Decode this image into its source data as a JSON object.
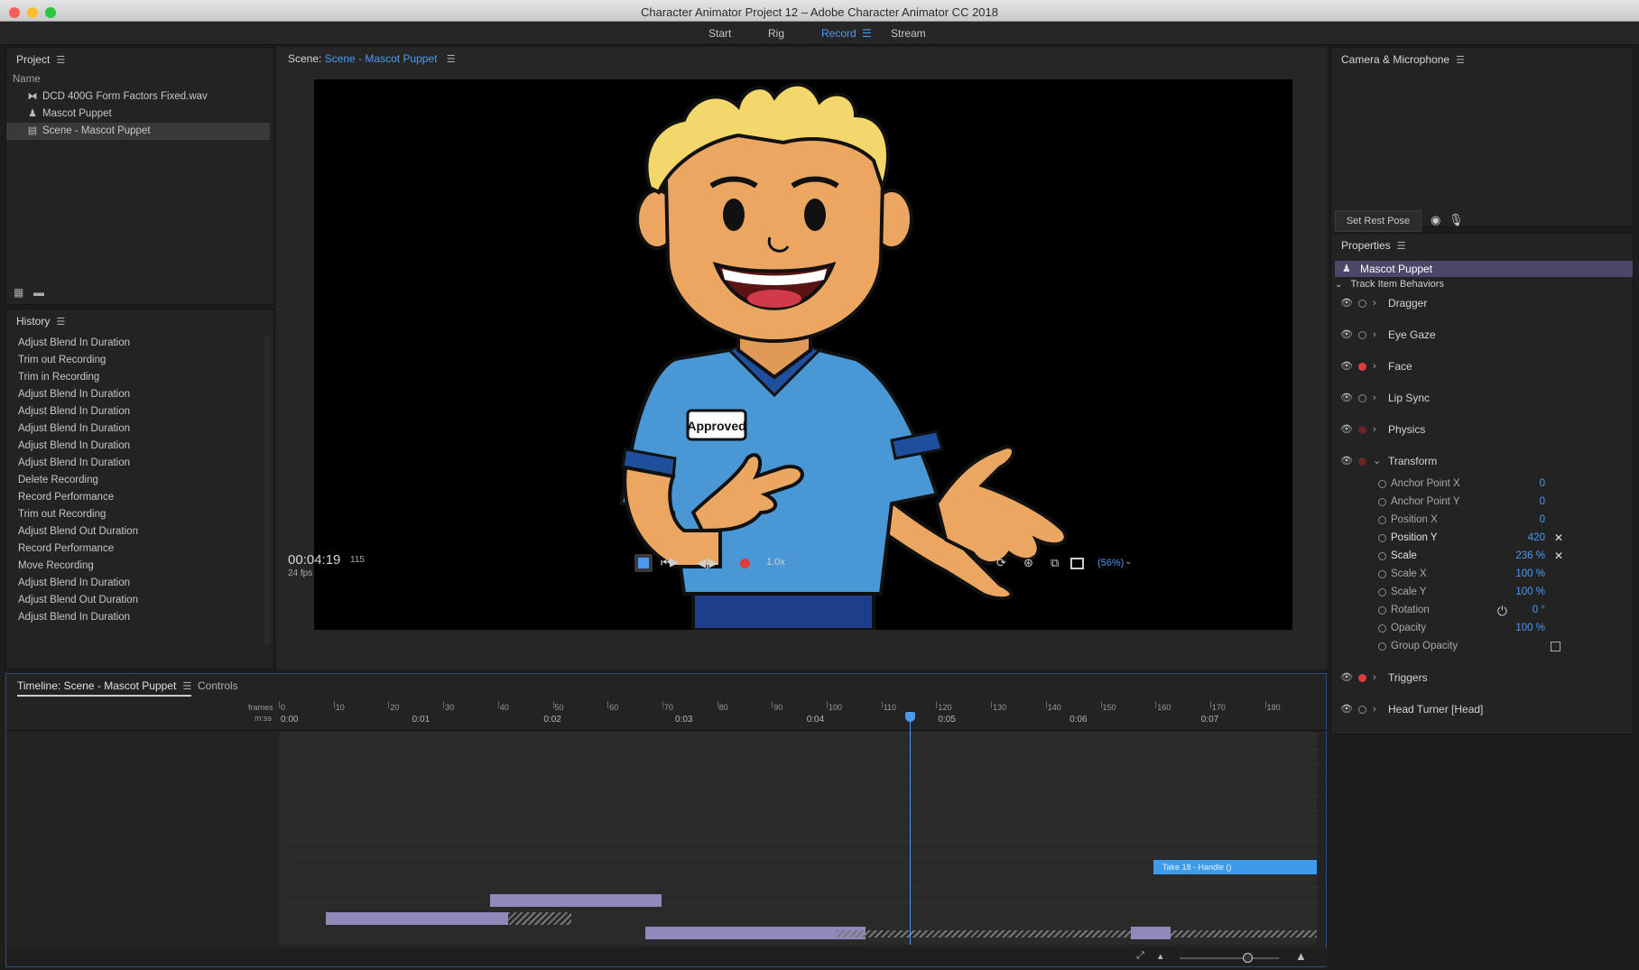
{
  "window": {
    "title": "Character Animator Project 12 – Adobe Character Animator CC 2018"
  },
  "workspace": {
    "tabs": [
      "Start",
      "Rig",
      "Record",
      "Stream"
    ],
    "active": "Record"
  },
  "project": {
    "title": "Project",
    "column_name": "Name",
    "items": [
      {
        "name": "DCD 400G Form Factors Fixed.wav",
        "icon": "audio-waveform-icon"
      },
      {
        "name": "Mascot Puppet",
        "icon": "puppet-icon"
      },
      {
        "name": "Scene - Mascot Puppet",
        "icon": "scene-clapper-icon",
        "selected": true
      }
    ]
  },
  "history": {
    "title": "History",
    "items": [
      "Adjust Blend In Duration",
      "Trim out Recording",
      "Trim in Recording",
      "Adjust Blend In Duration",
      "Adjust Blend In Duration",
      "Adjust Blend In Duration",
      "Adjust Blend In Duration",
      "Adjust Blend In Duration",
      "Delete Recording",
      "Record Performance",
      "Trim out Recording",
      "Adjust Blend Out Duration",
      "Record Performance",
      "Move Recording",
      "Adjust Blend In Duration",
      "Adjust Blend Out Duration",
      "Adjust Blend In Duration"
    ]
  },
  "scene": {
    "label": "Scene:",
    "name": "Scene - Mascot Puppet",
    "badge_text": "Approved",
    "timecode": "00:04:19",
    "frame": "115",
    "fps": "24 fps",
    "speed": "1.0x",
    "zoom": "(56%)"
  },
  "camera": {
    "title": "Camera & Microphone",
    "rest_pose": "Set Rest Pose"
  },
  "properties": {
    "title": "Properties",
    "puppet": "Mascot Puppet",
    "section": "Track Item Behaviors",
    "behaviors": [
      "Dragger",
      "Eye Gaze",
      "Face",
      "Lip Sync",
      "Physics",
      "Transform"
    ],
    "transform_params": [
      {
        "name": "Anchor Point X",
        "value": "0"
      },
      {
        "name": "Anchor Point Y",
        "value": "0"
      },
      {
        "name": "Position X",
        "value": "0"
      },
      {
        "name": "Position Y",
        "value": "420"
      },
      {
        "name": "Scale",
        "value": "236 %"
      },
      {
        "name": "Scale X",
        "value": "100 %"
      },
      {
        "name": "Scale Y",
        "value": "100 %"
      },
      {
        "name": "Rotation",
        "value": "0 °"
      },
      {
        "name": "Opacity",
        "value": "100 %"
      },
      {
        "name": "Group Opacity",
        "value": ""
      }
    ],
    "after": [
      "Triggers",
      "Head Turner [Head]"
    ]
  },
  "timeline": {
    "title": "Timeline: Scene - Mascot Puppet",
    "controls_tab": "Controls",
    "frames_label": "frames",
    "mss_label": "m:ss",
    "frame_ticks": [
      "0",
      "10",
      "20",
      "30",
      "40",
      "50",
      "60",
      "70",
      "80",
      "90",
      "100",
      "110",
      "120",
      "130",
      "140",
      "150",
      "160",
      "170",
      "180"
    ],
    "time_ticks": [
      "0:00",
      "0:01",
      "0:02",
      "0:03",
      "0:04",
      "0:05",
      "0:06",
      "0:07"
    ],
    "take_label": "Take 18 - Handle ()"
  }
}
